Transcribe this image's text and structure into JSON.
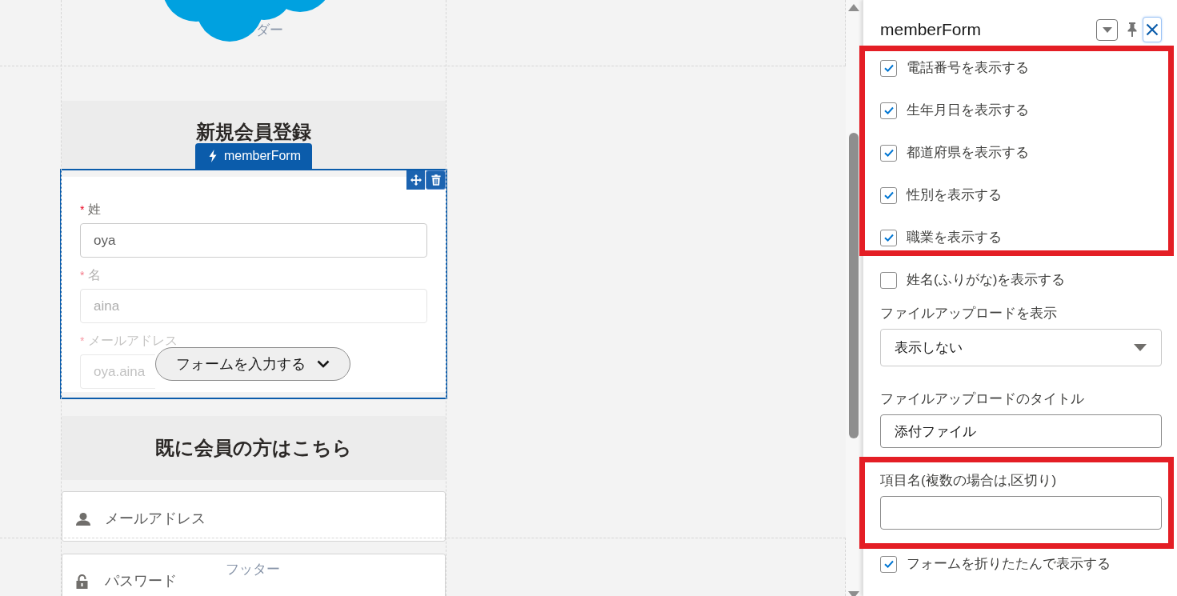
{
  "canvas": {
    "header_label": "ダー",
    "footer_label": "フッター"
  },
  "register": {
    "title": "新規会員登録",
    "component": {
      "name": "memberForm",
      "selected": true,
      "collapsed": true,
      "fields": [
        {
          "required_mark": "*",
          "label": "姓",
          "value": "oya"
        },
        {
          "required_mark": "*",
          "label": "名",
          "value": "aina"
        },
        {
          "required_mark": "*",
          "label": "メールアドレス",
          "value": "oya.aina"
        }
      ],
      "expand_button": "フォームを入力する"
    }
  },
  "login": {
    "title": "既に会員の方はこちら",
    "fields": [
      {
        "kind": "user",
        "placeholder": "メールアドレス"
      },
      {
        "kind": "password",
        "placeholder": "パスワード"
      }
    ]
  },
  "panel": {
    "title": "memberForm",
    "groups": [
      {
        "highlighted": true,
        "items": [
          {
            "kind": "checkbox",
            "label": "電話番号を表示する",
            "checked": true
          },
          {
            "kind": "checkbox",
            "label": "生年月日を表示する",
            "checked": true
          },
          {
            "kind": "checkbox",
            "label": "都道府県を表示する",
            "checked": true
          },
          {
            "kind": "checkbox",
            "label": "性別を表示する",
            "checked": true
          },
          {
            "kind": "checkbox",
            "label": "職業を表示する",
            "checked": true
          }
        ]
      },
      {
        "highlighted": false,
        "items": [
          {
            "kind": "checkbox",
            "label": "姓名(ふりがな)を表示する",
            "checked": false
          },
          {
            "kind": "select",
            "label": "ファイルアップロードを表示",
            "value": "表示しない"
          },
          {
            "kind": "text",
            "label": "ファイルアップロードのタイトル",
            "value": "添付ファイル"
          }
        ]
      },
      {
        "highlighted": true,
        "items": [
          {
            "kind": "text",
            "label": "項目名(複数の場合は,区切り)"
          }
        ]
      },
      {
        "highlighted": false,
        "items": [
          {
            "kind": "checkbox",
            "label": "フォームを折りたたんで表示する",
            "checked": true
          }
        ]
      }
    ]
  }
}
